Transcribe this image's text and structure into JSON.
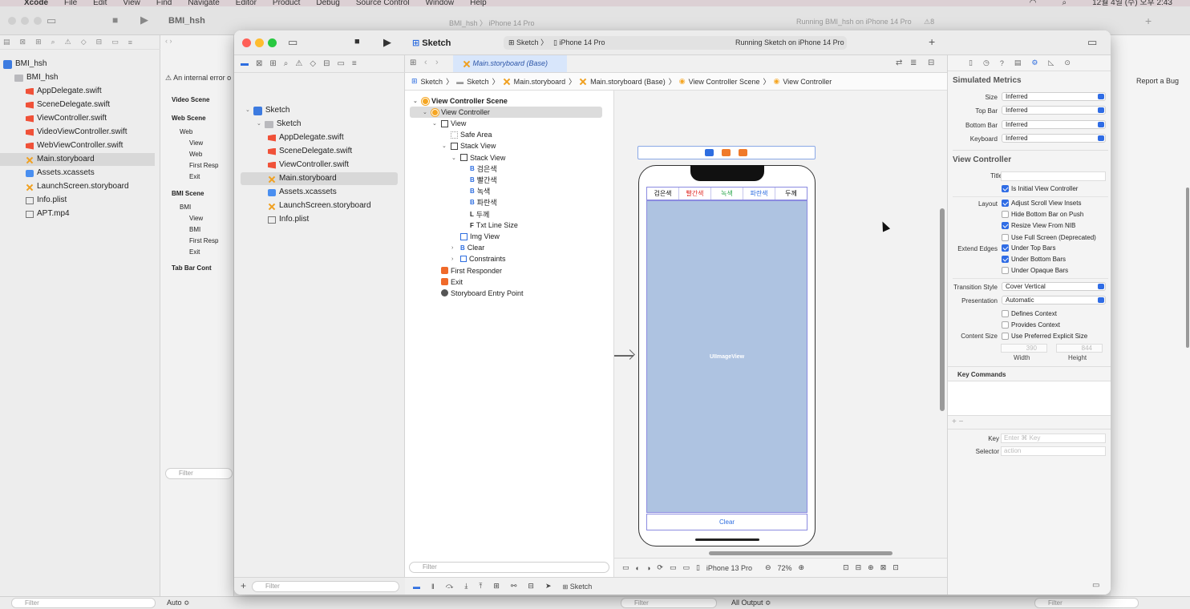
{
  "menubar": {
    "items": [
      "Xcode",
      "File",
      "Edit",
      "View",
      "Find",
      "Navigate",
      "Editor",
      "Product",
      "Debug",
      "Source Control",
      "Window",
      "Help"
    ],
    "clock": "12월 4일 (수) 오후 2:43"
  },
  "background_window": {
    "project": "BMI_hsh",
    "tab_text": "BMI_hsh 〉 iPhone 14 Pro",
    "running": "Running BMI_hsh on iPhone 14 Pro",
    "warning_count": "8",
    "nav_items": [
      {
        "label": "BMI_hsh",
        "kind": "app"
      },
      {
        "label": "BMI_hsh",
        "kind": "folder"
      },
      {
        "label": "AppDelegate.swift",
        "kind": "swift"
      },
      {
        "label": "SceneDelegate.swift",
        "kind": "swift"
      },
      {
        "label": "ViewController.swift",
        "kind": "swift"
      },
      {
        "label": "VideoViewController.swift",
        "kind": "swift"
      },
      {
        "label": "WebViewController.swift",
        "kind": "swift"
      },
      {
        "label": "Main.storyboard",
        "kind": "storyboard",
        "selected": true
      },
      {
        "label": "Assets.xcassets",
        "kind": "asset"
      },
      {
        "label": "LaunchScreen.storyboard",
        "kind": "storyboard"
      },
      {
        "label": "Info.plist",
        "kind": "plist"
      },
      {
        "label": "APT.mp4",
        "kind": "file"
      }
    ],
    "error_text": "An internal error o",
    "scenes": [
      "Video Scene",
      "Web Scene",
      "Web",
      "View",
      "Web",
      "First Resp",
      "Exit",
      "BMI Scene",
      "BMI",
      "View",
      "BMI",
      "First Resp",
      "Exit",
      "Tab Bar Cont"
    ],
    "report_bug": "Report a Bug",
    "filter_placeholder": "Filter",
    "auto_label": "Auto ≎",
    "all_output": "All Output ≎"
  },
  "window": {
    "project": "Sketch",
    "scheme": "Sketch",
    "device": "iPhone 14 Pro",
    "status": "Running Sketch on iPhone 14 Pro",
    "navigator": [
      {
        "label": "Sketch",
        "kind": "app",
        "indent": 0
      },
      {
        "label": "Sketch",
        "kind": "folder",
        "indent": 1
      },
      {
        "label": "AppDelegate.swift",
        "kind": "swift",
        "indent": 2
      },
      {
        "label": "SceneDelegate.swift",
        "kind": "swift",
        "indent": 2
      },
      {
        "label": "ViewController.swift",
        "kind": "swift",
        "indent": 2
      },
      {
        "label": "Main.storyboard",
        "kind": "storyboard",
        "indent": 2,
        "selected": true
      },
      {
        "label": "Assets.xcassets",
        "kind": "asset",
        "indent": 2
      },
      {
        "label": "LaunchScreen.storyboard",
        "kind": "storyboard",
        "indent": 2
      },
      {
        "label": "Info.plist",
        "kind": "plist",
        "indent": 2
      }
    ],
    "nav_filter": "Filter",
    "tab": "Main.storyboard (Base)",
    "jumpbar": [
      "Sketch",
      "Sketch",
      "Main.storyboard",
      "Main.storyboard (Base)",
      "View Controller Scene",
      "View Controller"
    ],
    "outline": [
      {
        "label": "View Controller Scene",
        "icon": "scene",
        "indent": 0,
        "bold": true
      },
      {
        "label": "View Controller",
        "icon": "vc",
        "indent": 1,
        "selected": true
      },
      {
        "label": "View",
        "icon": "view",
        "indent": 2
      },
      {
        "label": "Safe Area",
        "icon": "safe",
        "indent": 3
      },
      {
        "label": "Stack View",
        "icon": "view",
        "indent": 3
      },
      {
        "label": "Stack View",
        "icon": "view",
        "indent": 4
      },
      {
        "label": "검은색",
        "icon": "B",
        "indent": 5
      },
      {
        "label": "빨간색",
        "icon": "B",
        "indent": 5
      },
      {
        "label": "녹색",
        "icon": "B",
        "indent": 5
      },
      {
        "label": "파란색",
        "icon": "B",
        "indent": 5
      },
      {
        "label": "두께",
        "icon": "L",
        "indent": 5
      },
      {
        "label": "Txt Line Size",
        "icon": "F",
        "indent": 5
      },
      {
        "label": "Img View",
        "icon": "img",
        "indent": 4
      },
      {
        "label": "Clear",
        "icon": "B",
        "indent": 4
      },
      {
        "label": "Constraints",
        "icon": "constraints",
        "indent": 4
      },
      {
        "label": "First Responder",
        "icon": "fr",
        "indent": 2
      },
      {
        "label": "Exit",
        "icon": "exit",
        "indent": 2
      },
      {
        "label": "Storyboard Entry Point",
        "icon": "ep",
        "indent": 2
      }
    ],
    "outline_filter": "Filter",
    "phone": {
      "buttons": [
        {
          "label": "검은색",
          "color": "#111111"
        },
        {
          "label": "빨간색",
          "color": "#e0302a"
        },
        {
          "label": "녹색",
          "color": "#2fa84f"
        },
        {
          "label": "파란색",
          "color": "#2d6de0"
        },
        {
          "label": "두께",
          "color": "#111111"
        }
      ],
      "image_label": "UIImageView",
      "clear_label": "Clear"
    },
    "device_bar": {
      "device": "iPhone 13 Pro",
      "zoom": "72%"
    },
    "bottom_scheme": "Sketch"
  },
  "inspector": {
    "simulated_metrics": "Simulated Metrics",
    "metrics": [
      {
        "label": "Size",
        "value": "Inferred"
      },
      {
        "label": "Top Bar",
        "value": "Inferred"
      },
      {
        "label": "Bottom Bar",
        "value": "Inferred"
      },
      {
        "label": "Keyboard",
        "value": "Inferred"
      }
    ],
    "vc_header": "View Controller",
    "title_label": "Title",
    "is_initial": "Is Initial View Controller",
    "layout_label": "Layout",
    "layout_opts": [
      {
        "label": "Adjust Scroll View Insets",
        "on": true
      },
      {
        "label": "Hide Bottom Bar on Push",
        "on": false
      },
      {
        "label": "Resize View From NIB",
        "on": true
      },
      {
        "label": "Use Full Screen (Deprecated)",
        "on": false
      }
    ],
    "extend_label": "Extend Edges",
    "extend_opts": [
      {
        "label": "Under Top Bars",
        "on": true
      },
      {
        "label": "Under Bottom Bars",
        "on": true
      },
      {
        "label": "Under Opaque Bars",
        "on": false
      }
    ],
    "transition_label": "Transition Style",
    "transition_value": "Cover Vertical",
    "presentation_label": "Presentation",
    "presentation_value": "Automatic",
    "defines_context": "Defines Context",
    "provides_context": "Provides Context",
    "content_size_label": "Content Size",
    "use_preferred": "Use Preferred Explicit Size",
    "width_value": "390",
    "height_value": "844",
    "width_label": "Width",
    "height_label": "Height",
    "key_commands": "Key Commands",
    "key_label": "Key",
    "key_placeholder": "Enter ⌘ Key",
    "selector_label": "Selector",
    "selector_placeholder": "action"
  }
}
